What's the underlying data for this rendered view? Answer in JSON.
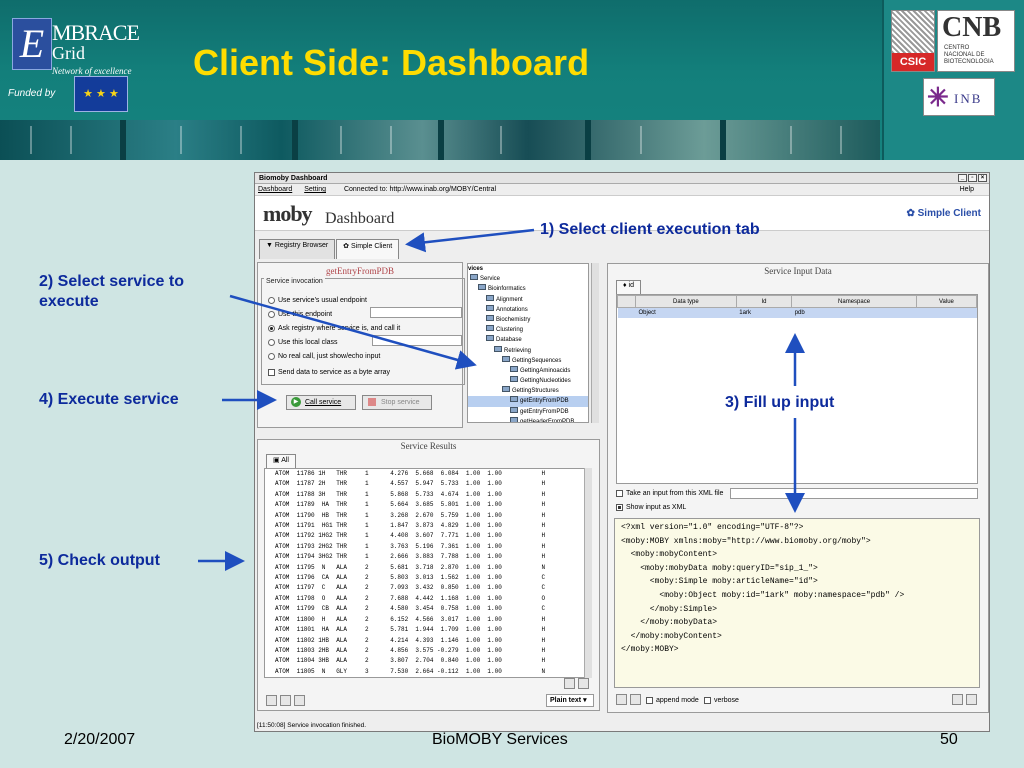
{
  "header": {
    "title": "Client Side: Dashboard",
    "logo_line1": "MBRACE",
    "logo_line2": "Grid",
    "logo_line3": "Network of excellence",
    "logo_letter": "E",
    "funded_by": "Funded by",
    "csic": "CSIC",
    "cnb": "CNB",
    "cnb_sub": [
      "CENTRO",
      "NACIONAL DE",
      "BIOTECNOLOGIA"
    ],
    "inb": "INB"
  },
  "window": {
    "title": "Biomoby Dashboard",
    "menu": [
      "Dashboard",
      "Setting"
    ],
    "connected": "Connected to: http://www.inab.org/MOBY/Central",
    "help": "Help",
    "moby": "moby",
    "dashboard": "Dashboard",
    "simple_client_link": "Simple Client",
    "tabs": [
      "Registry Browser",
      "Simple Client"
    ]
  },
  "left": {
    "service_title": "getEntryFromPDB",
    "legend": "Service invocation",
    "radios": [
      {
        "label": "Use service's usual endpoint",
        "on": false
      },
      {
        "label": "Use this endpoint",
        "on": false
      },
      {
        "label": "Ask registry where service is, and call it",
        "on": true
      },
      {
        "label": "Use this local class",
        "on": false
      },
      {
        "label": "No real call, just show/echo input",
        "on": false
      }
    ],
    "send_bytes": "Send data to service as a byte array",
    "call_btn": "Call service",
    "stop_btn": "Stop service"
  },
  "tree": {
    "header": "vices",
    "items": [
      {
        "t": "Service",
        "d": 0
      },
      {
        "t": "Bioinformatics",
        "d": 1
      },
      {
        "t": "Alignment",
        "d": 2
      },
      {
        "t": "Annotations",
        "d": 2
      },
      {
        "t": "Biochemistry",
        "d": 2
      },
      {
        "t": "Clustering",
        "d": 2
      },
      {
        "t": "Database",
        "d": 2
      },
      {
        "t": "Retrieving",
        "d": 3
      },
      {
        "t": "GettingSequences",
        "d": 4
      },
      {
        "t": "GettingAminoacids",
        "d": 5
      },
      {
        "t": "GettingNucleotides",
        "d": 5
      },
      {
        "t": "GettingStructures",
        "d": 4
      },
      {
        "t": "getEntryFromPDB",
        "d": 5
      },
      {
        "t": "getEntryFromPDB",
        "d": 5
      },
      {
        "t": "getHeaderFromPDB",
        "d": 5
      }
    ],
    "selected": 12
  },
  "results": {
    "title": "Service Results",
    "tab": "All",
    "lines": [
      "ATOM  11786 1H   THR     1      4.276  5.668  6.084  1.00  1.00           H",
      "ATOM  11787 2H   THR     1      4.557  5.947  5.733  1.00  1.00           H",
      "ATOM  11788 3H   THR     1      5.868  5.733  4.674  1.00  1.00           H",
      "ATOM  11789  HA  THR     1      5.664  3.685  5.801  1.00  1.00           H",
      "ATOM  11790  HB  THR     1      3.268  2.670  5.759  1.00  1.00           H",
      "ATOM  11791  HG1 THR     1      1.847  3.873  4.829  1.00  1.00           H",
      "ATOM  11792 1HG2 THR     1      4.408  3.607  7.771  1.00  1.00           H",
      "ATOM  11793 2HG2 THR     1      3.763  5.196  7.361  1.00  1.00           H",
      "ATOM  11794 3HG2 THR     1      2.666  3.883  7.788  1.00  1.00           H",
      "ATOM  11795  N   ALA     2      5.681  3.718  2.870  1.00  1.00           N",
      "ATOM  11796  CA  ALA     2      5.803  3.013  1.562  1.00  1.00           C",
      "ATOM  11797  C   ALA     2      7.093  3.432  0.850  1.00  1.00           C",
      "ATOM  11798  O   ALA     2      7.688  4.442  1.168  1.00  1.00           O",
      "ATOM  11799  CB  ALA     2      4.580  3.454  0.758  1.00  1.00           C",
      "ATOM  11800  H   ALA     2      6.152  4.566  3.017  1.00  1.00           H",
      "ATOM  11801  HA  ALA     2      5.781  1.944  1.709  1.00  1.00           H",
      "ATOM  11802 1HB  ALA     2      4.214  4.393  1.146  1.00  1.00           H",
      "ATOM  11803 2HB  ALA     2      4.856  3.575 -0.279  1.00  1.00           H",
      "ATOM  11804 3HB  ALA     2      3.807  2.704  0.840  1.00  1.00           H",
      "ATOM  11805  N   GLY     3      7.530  2.664 -0.112  1.00  1.00           N",
      "ATOM  11806  CA  GLY     3      8.779  3.022 -0.842  1.00  1.00           C"
    ],
    "plain_text": "Plain text"
  },
  "input": {
    "title": "Service Input Data",
    "tab": "id",
    "columns": [
      "Data type",
      "Id",
      "Namespace",
      "Value"
    ],
    "row": {
      "type": "Object",
      "id": "1ark",
      "ns": "pdb",
      "value": ""
    },
    "take_xml": "Take an input from this XML file",
    "show_xml": "Show input as XML",
    "xml": [
      "<?xml version=\"1.0\" encoding=\"UTF-8\"?>",
      "<moby:MOBY xmlns:moby=\"http://www.biomoby.org/moby\">",
      "  <moby:mobyContent>",
      "    <moby:mobyData moby:queryID=\"sip_1_\">",
      "      <moby:Simple moby:articleName=\"id\">",
      "        <moby:Object moby:id=\"1ark\" moby:namespace=\"pdb\" />",
      "      </moby:Simple>",
      "    </moby:mobyData>",
      "  </moby:mobyContent>",
      "</moby:MOBY>"
    ],
    "append": "append mode",
    "verbose": "verbose"
  },
  "status": "[11:50:08] Service invocation finished.",
  "annotations": {
    "a1": "1) Select client execution tab",
    "a2": "2) Select service to execute",
    "a3": "3) Fill up input",
    "a4": "4) Execute service",
    "a5": "5) Check output"
  },
  "footer": {
    "date": "2/20/2007",
    "center": "BioMOBY Services",
    "page": "50"
  },
  "colors": {
    "title": "#ffdc00",
    "annotation": "#0d2a9c",
    "arrow": "#1f4fbf"
  }
}
